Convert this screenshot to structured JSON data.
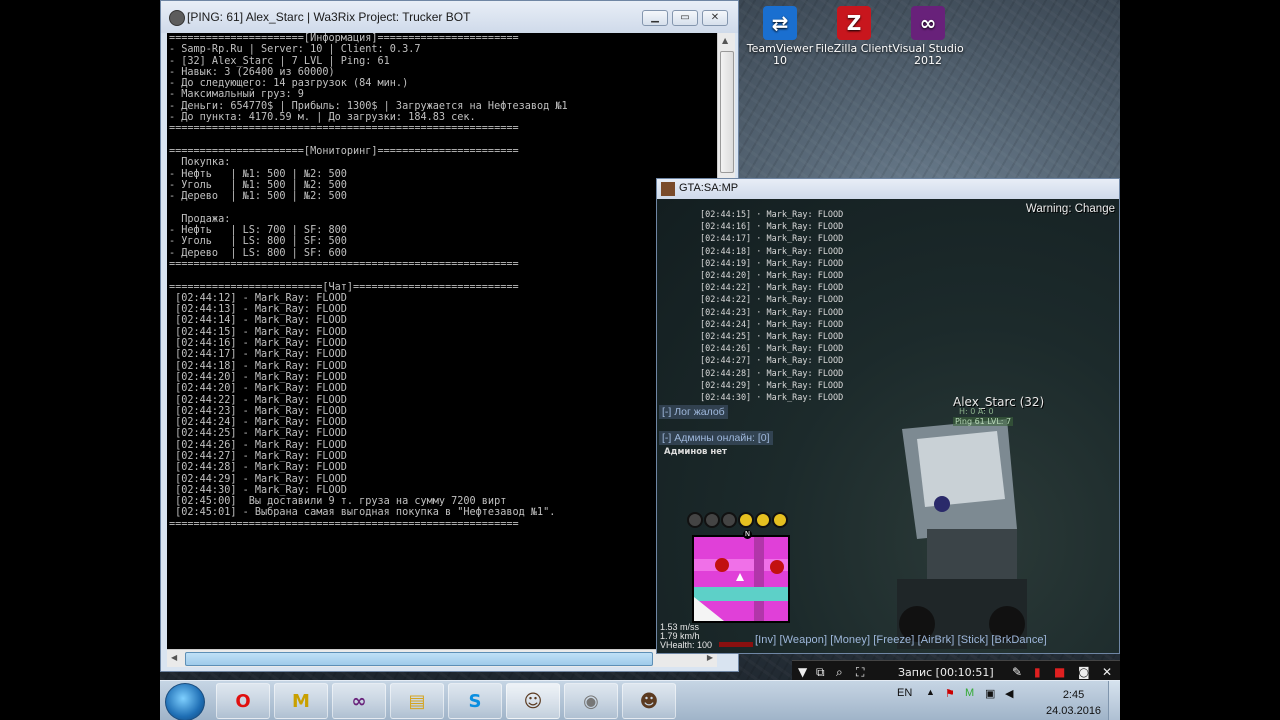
{
  "desktop_icons": [
    {
      "label": "TeamViewer 10",
      "icon": "teamviewer-icon",
      "color": "#1a6fd0"
    },
    {
      "label": "FileZilla Client",
      "icon": "filezilla-icon",
      "color": "#c8161d"
    },
    {
      "label": "Visual Studio 2012",
      "icon": "visual-studio-icon",
      "color": "#68217a"
    }
  ],
  "console_window": {
    "title": "[PING: 61] Alex_Starc | Wa3Rix Project: Trucker BOT",
    "buttons": {
      "minimize": "▁",
      "maximize": "▭",
      "close": "✕"
    },
    "lines": [
      "======================[Информация]=======================",
      "- Samp-Rp.Ru | Server: 10 | Client: 0.3.7",
      "- [32] Alex_Starc | 7 LVL | Ping: 61",
      "- Навык: 3 (26400 из 60000)",
      "- До следующего: 14 разгрузок (84 мин.)",
      "- Максимальный груз: 9",
      "- Деньги: 654770$ | Прибыль: 1300$ | Загружается на Нефтезавод №1",
      "- До пункта: 4170.59 м. | До загрузки: 184.83 сек.",
      "=========================================================",
      "",
      "======================[Мониторинг]=======================",
      "  Покупка:",
      "- Нефть   | №1: 500 | №2: 500",
      "- Уголь   | №1: 500 | №2: 500",
      "- Дерево  | №1: 500 | №2: 500",
      "",
      "  Продажа:",
      "- Нефть   | LS: 700 | SF: 800",
      "- Уголь   | LS: 800 | SF: 500",
      "- Дерево  | LS: 800 | SF: 600",
      "=========================================================",
      "",
      "=========================[Чат]===========================",
      " [02:44:12] - Mark_Ray: FLOOD",
      " [02:44:13] - Mark_Ray: FLOOD",
      " [02:44:14] - Mark_Ray: FLOOD",
      " [02:44:15] - Mark_Ray: FLOOD",
      " [02:44:16] - Mark_Ray: FLOOD",
      " [02:44:17] - Mark_Ray: FLOOD",
      " [02:44:18] - Mark_Ray: FLOOD",
      " [02:44:20] - Mark_Ray: FLOOD",
      " [02:44:20] - Mark_Ray: FLOOD",
      " [02:44:22] - Mark_Ray: FLOOD",
      " [02:44:23] - Mark_Ray: FLOOD",
      " [02:44:24] - Mark_Ray: FLOOD",
      " [02:44:25] - Mark_Ray: FLOOD",
      " [02:44:26] - Mark_Ray: FLOOD",
      " [02:44:27] - Mark_Ray: FLOOD",
      " [02:44:28] - Mark_Ray: FLOOD",
      " [02:44:29] - Mark_Ray: FLOOD",
      " [02:44:30] - Mark_Ray: FLOOD",
      " [02:45:00]  Вы доставили 9 т. груза на сумму 7200 вирт",
      " [02:45:01] - Выбрана самая выгодная покупка в \"Нефтезавод №1\".",
      "========================================================="
    ]
  },
  "gta_window": {
    "title": "GTA:SA:MP",
    "warning": "Warning: Change",
    "chat": [
      "[02:44:15] · Mark_Ray: FLOOD",
      "[02:44:16] · Mark_Ray: FLOOD",
      "[02:44:17] · Mark_Ray: FLOOD",
      "[02:44:18] · Mark_Ray: FLOOD",
      "[02:44:19] · Mark_Ray: FLOOD",
      "[02:44:20] · Mark_Ray: FLOOD",
      "[02:44:22] · Mark_Ray: FLOOD",
      "[02:44:22] · Mark_Ray: FLOOD",
      "[02:44:23] · Mark_Ray: FLOOD",
      "[02:44:24] · Mark_Ray: FLOOD",
      "[02:44:25] · Mark_Ray: FLOOD",
      "[02:44:26] · Mark_Ray: FLOOD",
      "[02:44:27] · Mark_Ray: FLOOD",
      "[02:44:28] · Mark_Ray: FLOOD",
      "[02:44:29] · Mark_Ray: FLOOD",
      "[02:44:30] · Mark_Ray: FLOOD"
    ],
    "complaints_log": "[-] Лог жалоб",
    "admins_online": "[-] Админы онлайн: [0]",
    "no_admins": "Админов нет",
    "player_name": "Alex_Starc (32)",
    "player_hp": "H: 0  A: 0",
    "player_ping": "Ping 61  LVL: 7",
    "speed": "1.53 m/ss",
    "speed_kmh": "1.79 km/h",
    "vhealth": "VHealth: 100",
    "hotkeys": "[Inv] [Weapon] [Money] [Freeze] [AirBrk] [Stick] [BrkDance]",
    "radar_north": "N",
    "colors": {
      "hud": "#9fb8dc",
      "radar": "#e040d8"
    }
  },
  "recorder": {
    "label": "Запис [00:10:51]"
  },
  "taskbar": {
    "items": [
      "opera-icon",
      "mta-icon",
      "visual-studio-icon",
      "explorer-icon",
      "skype-icon",
      "gta-player-icon",
      "gta-disc-icon",
      "gta-player-icon-2"
    ],
    "lang": "EN",
    "time": "2:45",
    "date": "24.03.2016"
  }
}
